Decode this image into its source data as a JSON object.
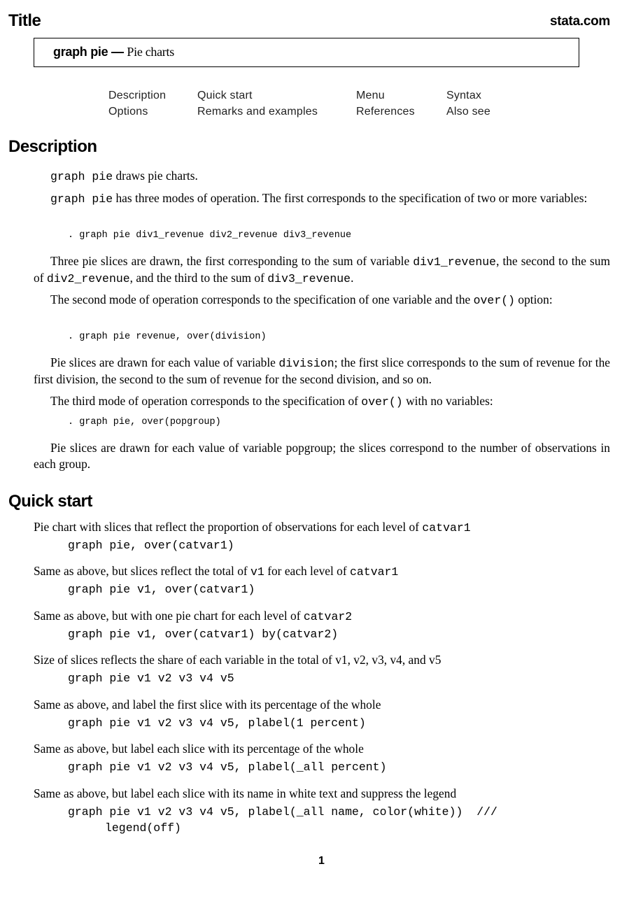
{
  "header": {
    "section_label": "Title",
    "brand": "stata.com"
  },
  "title_box": {
    "command": "graph pie",
    "dash": "—",
    "subtitle": "Pie charts"
  },
  "toc": {
    "items": [
      {
        "label": "Description"
      },
      {
        "label": "Quick start"
      },
      {
        "label": "Menu"
      },
      {
        "label": "Syntax"
      },
      {
        "label": "Options"
      },
      {
        "label": "Remarks and examples"
      },
      {
        "label": "References"
      },
      {
        "label": "Also see"
      }
    ]
  },
  "description": {
    "heading": "Description",
    "p1": {
      "code": "graph pie",
      "text": " draws pie charts."
    },
    "p2": {
      "code": "graph pie",
      "text": " has three modes of operation. The first corresponds to the specification of two or more variables:"
    },
    "example1": ". graph pie div1_revenue div2_revenue div3_revenue",
    "p3": {
      "t1": "Three pie slices are drawn, the first corresponding to the sum of variable ",
      "c1": "div1_revenue",
      "t2": ", the second to the sum of ",
      "c2": "div2_revenue",
      "t3": ", and the third to the sum of ",
      "c3": "div3_revenue",
      "t4": "."
    },
    "p4": {
      "t1": "The second mode of operation corresponds to the specification of one variable and the ",
      "c1": "over()",
      "t2": " option:"
    },
    "example2": ". graph pie revenue, over(division)",
    "p5": {
      "t1": "Pie slices are drawn for each value of variable ",
      "c1": "division",
      "t2": "; the first slice corresponds to the sum of revenue for the first division, the second to the sum of revenue for the second division, and so on."
    },
    "p6": {
      "t1": "The third mode of operation corresponds to the specification of ",
      "c1": "over()",
      "t2": " with no variables:"
    },
    "example3": ". graph pie, over(popgroup)",
    "p7": {
      "t1": "Pie slices are drawn for each value of variable popgroup; the slices correspond to the number of observations in each group."
    }
  },
  "quick_start": {
    "heading": "Quick start",
    "items": [
      {
        "desc_text": "Pie chart with slices that reflect the proportion of observations for each level of ",
        "desc_code": "catvar1",
        "desc_tail": "",
        "command": "graph pie, over(catvar1)",
        "continuation": ""
      },
      {
        "desc_text": "Same as above, but slices reflect the total of ",
        "desc_code": "v1",
        "desc_tail": " for each level of ",
        "desc_code2": "catvar1",
        "command": "graph pie v1, over(catvar1)",
        "continuation": ""
      },
      {
        "desc_text": "Same as above, but with one pie chart for each level of ",
        "desc_code": "catvar2",
        "desc_tail": "",
        "command": "graph pie v1, over(catvar1) by(catvar2)",
        "continuation": ""
      },
      {
        "desc_text": "Size of slices reflects the share of each variable in the total of ",
        "desc_code": "v1",
        "desc_tail": ", v2, v3, v4, and v5",
        "command": "graph pie v1 v2 v3 v4 v5",
        "continuation": ""
      },
      {
        "desc_text": "Same as above, and label the first slice with its percentage of the whole",
        "desc_code": "",
        "desc_tail": "",
        "command": "graph pie v1 v2 v3 v4 v5, plabel(1 percent)",
        "continuation": ""
      },
      {
        "desc_text": "Same as above, but label each slice with its percentage of the whole",
        "desc_code": "",
        "desc_tail": "",
        "command": "graph pie v1 v2 v3 v4 v5, plabel(_all percent)",
        "continuation": ""
      },
      {
        "desc_text": "Same as above, but label each slice with its name in white text and suppress the legend",
        "desc_code": "",
        "desc_tail": "",
        "command": "graph pie v1 v2 v3 v4 v5, plabel(_all name, color(white))  ///",
        "continuation": "legend(off)"
      }
    ]
  },
  "footer": {
    "page_number": "1"
  }
}
